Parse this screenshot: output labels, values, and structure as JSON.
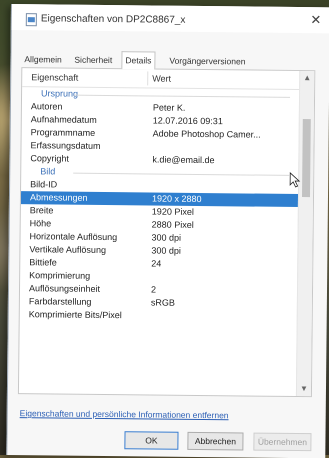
{
  "window": {
    "title": "Eigenschaften von DP2C8867_x",
    "close_glyph": "✕"
  },
  "tabs": [
    "Allgemein",
    "Sicherheit",
    "Details",
    "Vorgängerversionen"
  ],
  "active_tab": "Details",
  "table": {
    "col_property": "Eigenschaft",
    "col_value": "Wert",
    "rows": [
      {
        "type": "group",
        "property": "Ursprung",
        "value": ""
      },
      {
        "type": "row",
        "property": "Autoren",
        "value": "Peter K."
      },
      {
        "type": "row",
        "property": "Aufnahmedatum",
        "value": "12.07.2016 09:31"
      },
      {
        "type": "row",
        "property": "Programmname",
        "value": "Adobe Photoshop Camer..."
      },
      {
        "type": "row",
        "property": "Erfassungsdatum",
        "value": ""
      },
      {
        "type": "row",
        "property": "Copyright",
        "value": "k.die@email.de"
      },
      {
        "type": "group",
        "property": "Bild",
        "value": ""
      },
      {
        "type": "row",
        "property": "Bild-ID",
        "value": ""
      },
      {
        "type": "row",
        "property": "Abmessungen",
        "value": "1920 x 2880",
        "selected": true
      },
      {
        "type": "row",
        "property": "Breite",
        "value": "1920 Pixel"
      },
      {
        "type": "row",
        "property": "Höhe",
        "value": "2880 Pixel"
      },
      {
        "type": "row",
        "property": "Horizontale Auflösung",
        "value": "300 dpi"
      },
      {
        "type": "row",
        "property": "Vertikale Auflösung",
        "value": "300 dpi"
      },
      {
        "type": "row",
        "property": "Bittiefe",
        "value": "24"
      },
      {
        "type": "row",
        "property": "Komprimierung",
        "value": ""
      },
      {
        "type": "row",
        "property": "Auflösungseinheit",
        "value": "2"
      },
      {
        "type": "row",
        "property": "Farbdarstellung",
        "value": "sRGB"
      },
      {
        "type": "row",
        "property": "Komprimierte Bits/Pixel",
        "value": ""
      }
    ]
  },
  "scrollbar": {
    "up_glyph": "▲",
    "down_glyph": "▼"
  },
  "link": "Eigenschaften und persönliche Informationen entfernen",
  "buttons": {
    "ok": "OK",
    "cancel": "Abbrechen",
    "apply": "Übernehmen"
  },
  "colors": {
    "selection": "#2f7fcf",
    "group_label": "#3b70b8",
    "link": "#2c5fb5"
  }
}
